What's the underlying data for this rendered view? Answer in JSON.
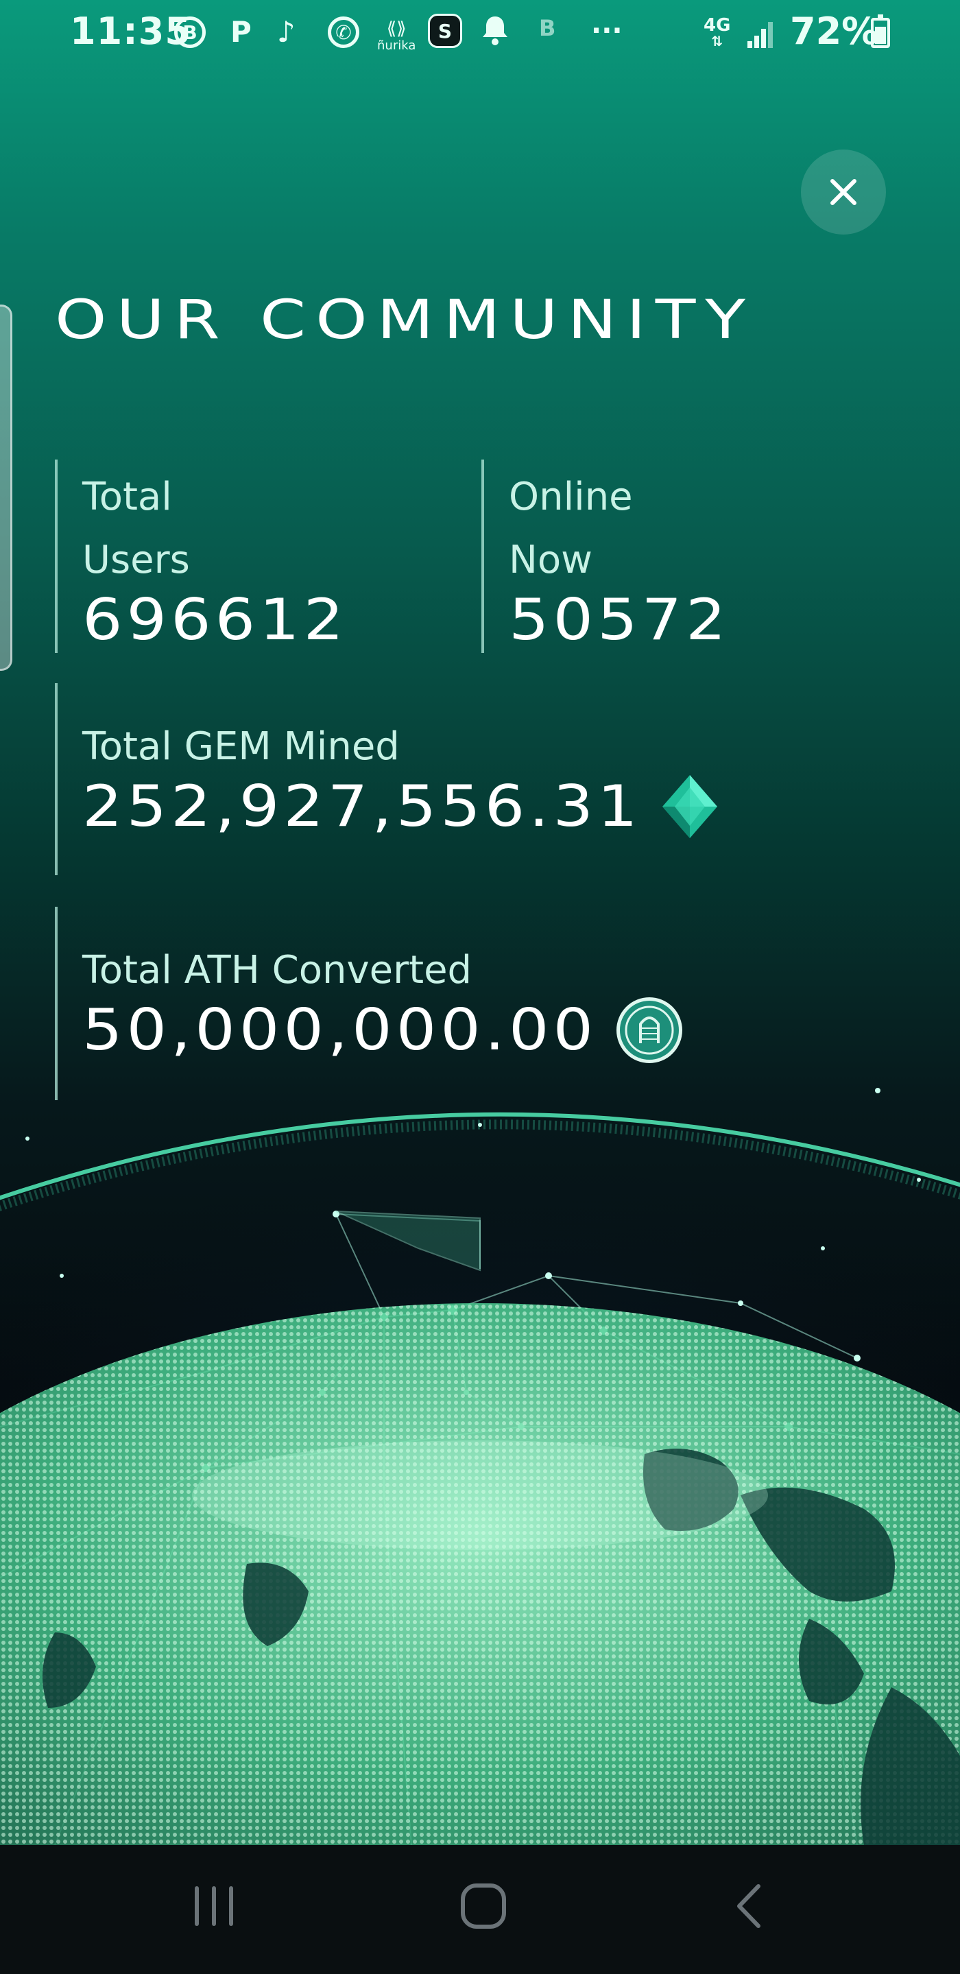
{
  "status_bar": {
    "time": "11:35",
    "icons": [
      "b-circle-icon",
      "p-icon",
      "tiktok-icon",
      "whatsapp-icon",
      "nurika-icon",
      "app-s-icon",
      "bell-icon",
      "b-icon",
      "more-dots-icon"
    ],
    "nurika_label": "ñurika",
    "network": "4G",
    "battery": "72%"
  },
  "page": {
    "title": "OUR COMMUNITY",
    "close_icon": "close-icon"
  },
  "stats": {
    "total_users": {
      "label_line1": "Total",
      "label_line2": "Users",
      "value": "696612"
    },
    "online_now": {
      "label_line1": "Online",
      "label_line2": "Now",
      "value": "50572"
    },
    "total_gem_mined": {
      "label": "Total GEM Mined",
      "value": "252,927,556.31",
      "icon": "gem-icon"
    },
    "total_ath_converted": {
      "label": "Total ATH Converted",
      "value": "50,000,000.00",
      "icon": "ath-coin-icon"
    }
  },
  "nav_bar": {
    "buttons": [
      "recent-apps-icon",
      "home-icon",
      "back-icon"
    ]
  },
  "colors": {
    "accent": "#0a9a7c",
    "gem": "#2fd6b0",
    "text": "#ffffff",
    "label": "#c8f2e6"
  }
}
